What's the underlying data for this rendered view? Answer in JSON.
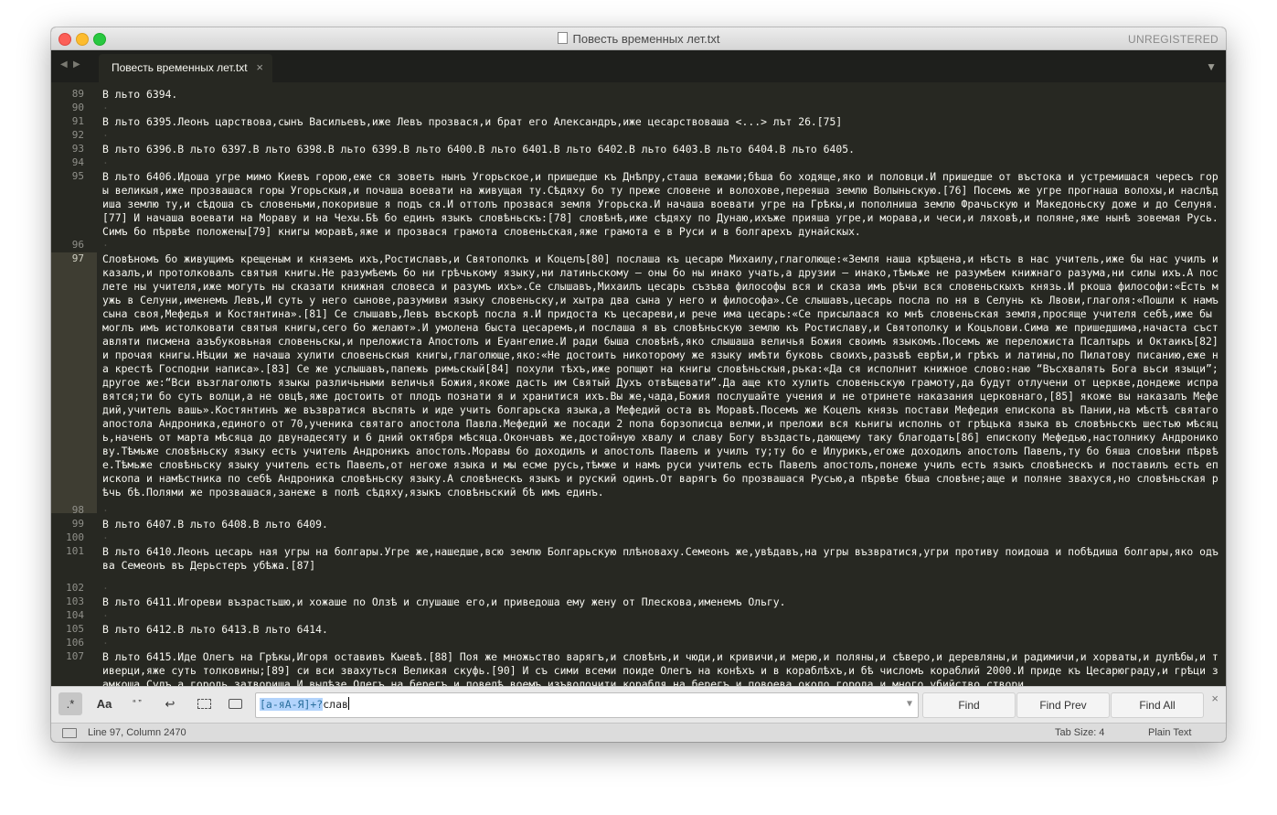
{
  "window": {
    "title": "Повесть временных лет.txt",
    "registration": "UNREGISTERED"
  },
  "tabbar": {
    "nav_back": "◀",
    "nav_forward": "▶",
    "tab_label": "Повесть временных лет.txt",
    "tab_close": "×",
    "menu_icon": "▼"
  },
  "editor": {
    "active_line": 97,
    "line_numbers": [
      "89",
      "90",
      "91",
      "92",
      "93",
      "94",
      "95",
      "96",
      "97",
      "98",
      "99",
      "100",
      "101",
      "102",
      "103",
      "104",
      "105",
      "106",
      "107"
    ],
    "lines": [
      "В льто 6394.",
      "·",
      "В льто 6395.Леонъ царствова,сынъ Васильевъ,иже Левъ прозвася,и брат его Александръ,иже цесарствоваша <...> лът 26.[75]",
      "·",
      "В льто 6396.В льто 6397.В льто 6398.В льто 6399.В льто 6400.В льто 6401.В льто 6402.В льто 6403.В льто 6404.В льто 6405.",
      "·",
      "В льто 6406.Идоша угре мимо Киевъ горою,еже ся зоветь нынъ Угорьское,и пришедше къ Днѣпру,сташа вежами;бѣша бо ходяще,яко и половци.И пришедше от въстока и устремишася чересъ горы великыя,иже прозвашася горы Угорьскыя,и почаша воевати на живущая ту.Сѣдяху бо ту преже словене и волохове,переяша землю Волыньскую.[76] Посемъ же угре прогнаша волохы,и наслѣдиша землю ту,и сѣдоша съ словеньми,покоривше я подъ ся.И оттолъ прозвася земля Угорьска.И начаша воевати угре на Грѣкы,и пополниша землю Фрачьскую и Македоньску доже и до Селуня.[77] И начаша воевати на Мораву и на Чехы.Бѣ бо единъ языкъ словѣньскъ:[78] словѣнѣ,иже сѣдяху по Дунаю,ихъже прияша угре,и морава,и чеси,и ляховѣ,и поляне,яже нынѣ зовемая Русь.Симъ бо пѣрвѣе положены[79] книгы моравѣ,яже и прозвася грамота словеньская,яже грамота е в Руси и в болгарехъ дунайскых.",
      "·",
      "Словѣномъ бо живущимъ крещеным и княземъ ихъ,Ростиславъ,и Святополкъ и Коцелъ[80] послаша къ цесарю Михаилу,глаголюще:«Земля наша крѣщена,и нѣсть в нас учитель,иже бы нас училъ и казалъ,и протолковалъ святыя книгы.Не разумѣемъ бо ни грѣчькому языку,ни латиньскому — оны бо ны инако учать,а друзии — инако,тѣмьже не разумѣем книжнаго разума,ни силы ихъ.А послете ны учителя,иже могуть ны сказати книжная словеса и разумъ ихъ».Се слышавъ,Михаилъ цесарь съзъва философы вся и сказа имъ рѣчи вся словеньскыхъ князь.И ркоша философи:«Есть мужь в Селуни,именемъ Левъ,И суть у него сынове,разумиви языку словеньску,и хытра два сына у него и философа».Се слышавъ,цесарь посла по ня в Селунь къ Лвови,глаголя:«Пошли к намъ сына своя,Мефедья и Костянтина».[81] Се слышавъ,Левъ въскорѣ посла я.И придоста къ цесареви,и рече има цесарь:«Се присылаася ко мнѣ словеньская земля,просяще учителя себѣ,иже бы моглъ имъ истолковати святыя книгы,сего бо желают».И умолена быста цесаремъ,и послаша я въ словѣньскую землю къ Ростиславу,и Святополку и Коцьлови.Сима же пришедшима,начаста съставляти писмена азъбуковьная словеньскы,и преложиста Апостолъ и Еуангелие.И ради быша словѣнѣ,яко слышаша величья Божия своимъ языкомъ.Посемъ же переложиста Псалтырь и Октаикъ[82] и прочая книгы.Нѣции же начаша хулити словеньскыя книгы,глаголюще,яко:«Не достоить никоторому же языку имѣти буковь своихъ,разъвѣ еврѣи,и грѣкъ и латины,по Пилатову писанию,еже на крестѣ Господни написа».[83] Се же услышавъ,папежь римьскый[84] похули тѣхъ,иже ропщют на книгы словѣньскыя,рька:«Да ся исполнит книжное слово:наю “Въсхвалять Бога вьси языци”;другое же:“Вси възглаголють языкы различьными величья Божия,якоже дасть им Святый Духъ отвѣщевати”.Да аще кто хулить словеньскую грамоту,да будут отлучени от церкве,дондеже исправятся;ти бо суть волци,а не овцѣ,яже достоить от плодъ познати я и хранитися ихъ.Вы же,чада,Божия послушайте учения и не отринете наказания церковнаго,[85] якоже вы наказалъ Мефедий,учитель вашь».Костянтинъ же възвратися въспять и иде учить болгарьска языка,а Мефедий оста въ Моравѣ.Посемъ же Коцелъ князь постави Мефедия епископа въ Пании,на мѣстѣ святаго апостола Андроника,единого от 70,ученика святаго апостола Павла.Мефедий же посади 2 попа борзописца велми,и преложи вся кьнигы исполнь от грѣцька языка въ словѣньскъ шестью мѣсяць,наченъ от марта мѣсяца до двунадесяту и 6 дний октября мѣсяца.Окончавъ же,достойную хвалу и славу Богу въздасть,дающему таку благодать[86] епископу Мефедью,настолнику Андроникову.Тѣмьже словѣньску языку есть учитель Андроникъ апостолъ.Моравы бо доходилъ и апостолъ Павелъ и училъ ту;ту бо е Илурикъ,егоже доходилъ апостолъ Павелъ,ту бо бяша словѣни пѣрвѣе.Тѣмьже словѣньску языку учитель есть Павелъ,от негоже языка и мы есме русь,тѣмже и намъ руси учитель есть Павелъ апостолъ,понеже училъ есть языкъ словѣнескъ и поставилъ есть епископа и намѣстника по себѣ Андроника словѣньску языку.А словѣнескъ языкъ и руский одинъ.От варягъ бо прозвашася Русью,а пѣрвѣе бѣша словѣне;аще и поляне звахуся,но словѣньская рѣчь бѣ.Полями же прозвашася,занеже в полѣ сѣдяху,языкъ словѣньский бѣ имъ единъ.",
      "·",
      "В льто 6407.В льто 6408.В льто 6409.",
      "·",
      "В льто 6410.Леонъ цесарь ная угры на болгары.Угре же,нашедше,всю землю Болгарьскую плѣноваху.Семеонъ же,увѣдавъ,на угры възвратися,угри противу поидоша и побѣдиша болгары,яко одъва Семеонъ въ Дерьстеръ убѣжа.[87]",
      "·",
      "В льто 6411.Игореви възрастьшю,и хожаше по Олзѣ и слушаше его,и приведоша ему жену от Плескова,именемъ Ольгу.",
      "·",
      "В льто 6412.В льто 6413.В льто 6414.",
      "·",
      "В льто 6415.Иде Олегъ на Грѣкы,Игоря оставивъ Кыевѣ.[88] Поя же множьство варягъ,и словѣнъ,и чюди,и кривичи,и мерю,и поляны,и сѣверо,и деревляны,и радимичи,и хорваты,и дулѣбы,и тиверци,яже суть толковины;[89] си вси звахуться Великая скуфь.[90] И съ сими всеми поиде Олегъ на конѣхъ и в кораблѣхъ,и бѣ числомъ кораблий 2000.И приде къ Цесарюграду,и грѣци замкоша Судъ,а городь затвориша.И вылѣзе Олегъ на берегъ,и повелѣ воемъ изъволочити корабля на берегъ,и повоева около города,и много убийство створи"
    ]
  },
  "findbar": {
    "opt_regex": ".*",
    "opt_case": "Aa",
    "opt_word": "“ ”",
    "opt_wrap": "↩",
    "query_selected": "[а-яА-Я]+?",
    "query_rest": "слав",
    "find": "Find",
    "find_prev": "Find Prev",
    "find_all": "Find All",
    "close": "×"
  },
  "statusbar": {
    "position": "Line 97, Column 2470",
    "tab_size": "Tab Size: 4",
    "syntax": "Plain Text"
  }
}
